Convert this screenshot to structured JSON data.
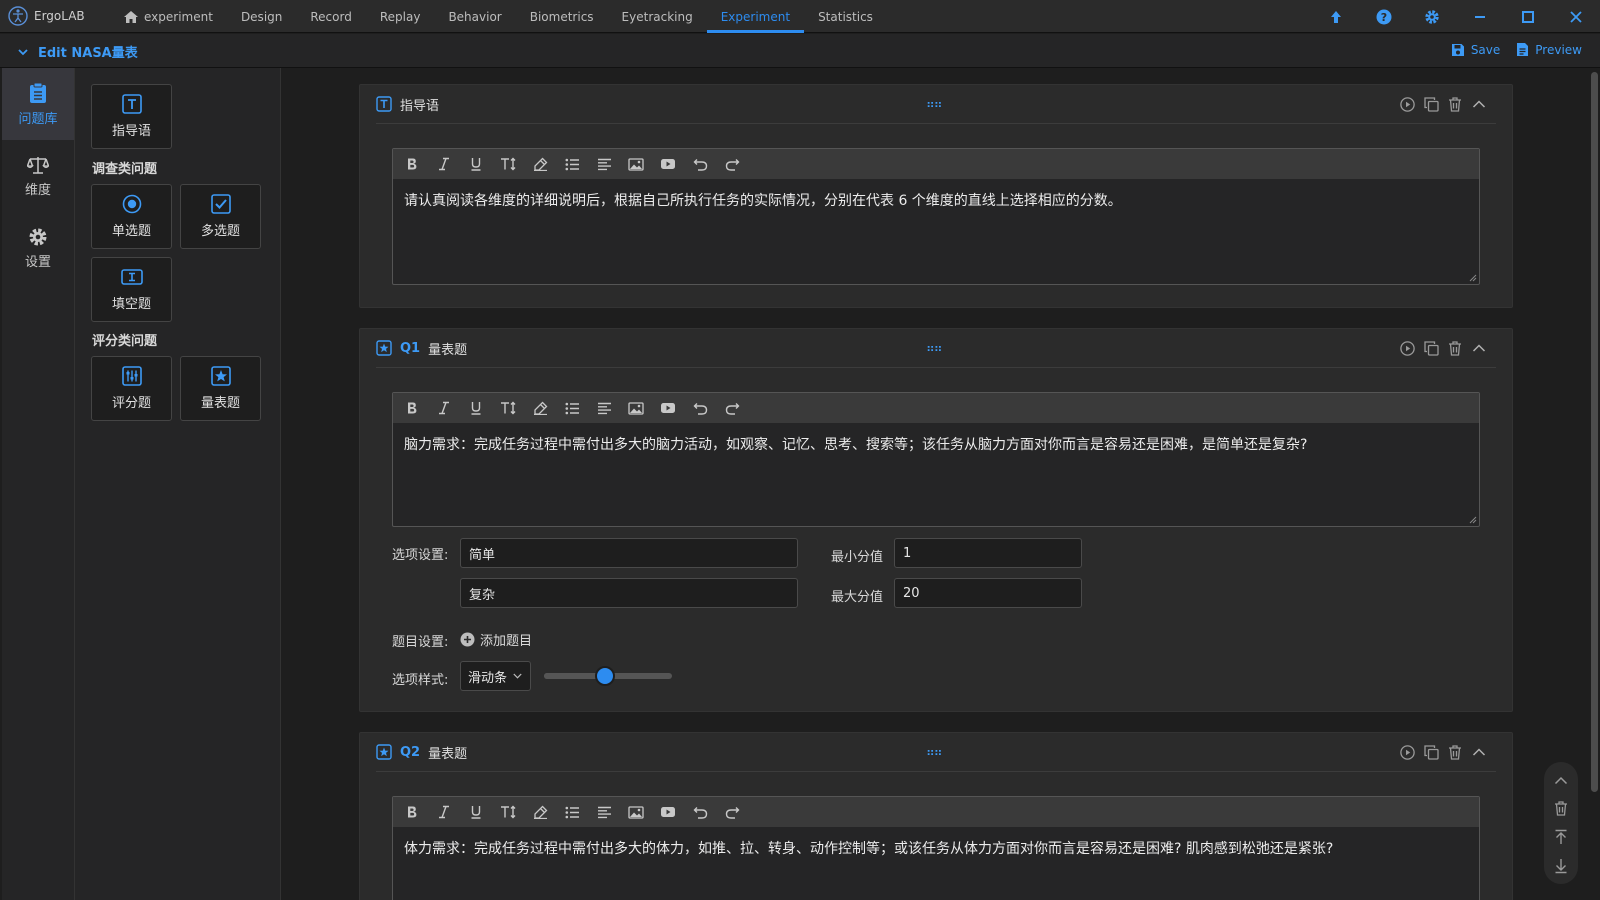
{
  "app": {
    "name": "ErgoLAB"
  },
  "nav": {
    "project": "experiment",
    "tabs": [
      "Design",
      "Record",
      "Replay",
      "Behavior",
      "Biometrics",
      "Eyetracking",
      "Experiment",
      "Statistics"
    ],
    "active_tab": "Experiment"
  },
  "window_icons": [
    "upload-icon",
    "help-icon",
    "settings-icon",
    "minimize-icon",
    "maximize-icon",
    "close-icon"
  ],
  "subbar": {
    "title": "Edit NASA量表",
    "save_label": "Save",
    "preview_label": "Preview"
  },
  "leftnav": {
    "items": [
      "问题库",
      "维度",
      "设置"
    ],
    "active": "问题库"
  },
  "palette": {
    "guide": "指导语",
    "section_survey": "调查类问题",
    "single": "单选题",
    "multi": "多选题",
    "fill": "填空题",
    "section_score": "评分类问题",
    "score": "评分题",
    "scale": "量表题"
  },
  "cards": [
    {
      "q": "",
      "title": "指导语",
      "content": "请认真阅读各维度的详细说明后，根据自己所执行任务的实际情况，分别在代表 6 个维度的直线上选择相应的分数。"
    },
    {
      "q": "Q1",
      "title": "量表题",
      "content": "脑力需求：完成任务过程中需付出多大的脑力活动，如观察、记忆、思考、搜索等；该任务从脑力方面对你而言是容易还是困难，是简单还是复杂?",
      "options_label": "选项设置:",
      "option1": "简单",
      "option2": "复杂",
      "min_label": "最小分值",
      "min_value": "1",
      "max_label": "最大分值",
      "max_value": "20",
      "items_label": "题目设置:",
      "add_item": "添加题目",
      "style_label": "选项样式:",
      "style_value": "滑动条",
      "slider_fraction": 0.48
    },
    {
      "q": "Q2",
      "title": "量表题",
      "content": "体力需求：完成任务过程中需付出多大的体力，如推、拉、转身、动作控制等；或该任务从体力方面对你而言是容易还是困难? 肌肉感到松弛还是紧张?"
    }
  ],
  "colors": {
    "accent": "#2d8cf0",
    "background": "#1e1e1e",
    "panel": "#2b2b2b"
  }
}
